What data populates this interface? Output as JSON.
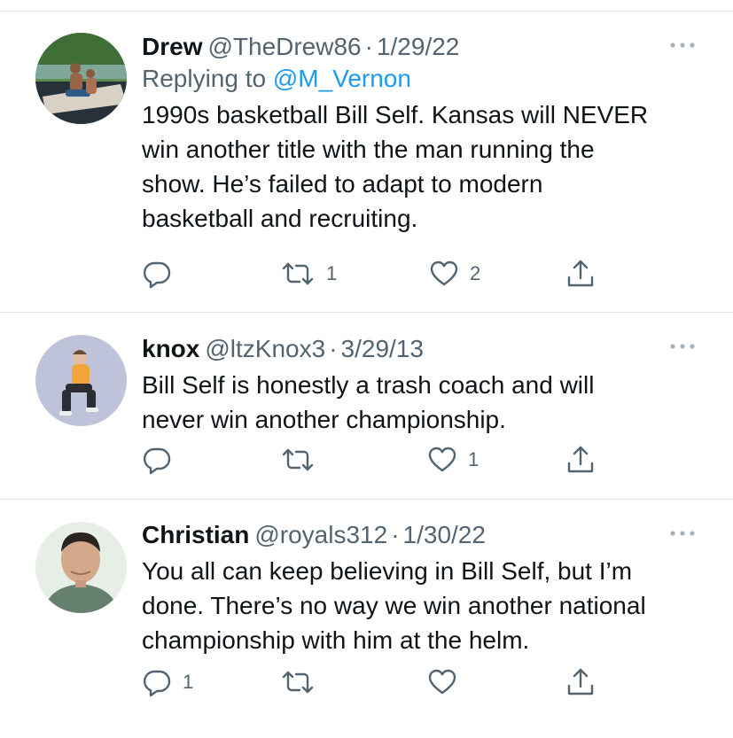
{
  "tweets": [
    {
      "name": "Drew",
      "handle": "@TheDrew86",
      "separator": "·",
      "date": "1/29/22",
      "reply_prefix": "Replying to ",
      "reply_target": "@M_Vernon",
      "text": "1990s basketball Bill Self. Kansas will NEVER\nwin another title with the man running the\nshow. He’s failed to adapt to modern\nbasketball and recruiting.",
      "replies": "",
      "retweets": "1",
      "likes": "2"
    },
    {
      "name": "knox",
      "handle": "@ltzKnox3",
      "separator": "·",
      "date": "3/29/13",
      "text": "Bill Self is honestly a trash coach and will\nnever win another championship.",
      "replies": "",
      "retweets": "",
      "likes": "1"
    },
    {
      "name": "Christian",
      "handle": "@royals312",
      "separator": "·",
      "date": "1/30/22",
      "text": "You all can keep believing in Bill Self, but I’m\ndone. There’s no way we win another national\nchampionship with him at the helm.",
      "replies": "1",
      "retweets": "",
      "likes": ""
    }
  ],
  "icons": {
    "reply": "reply-icon",
    "retweet": "retweet-icon",
    "like": "heart-icon",
    "share": "share-icon",
    "more": "more-icon"
  },
  "colors": {
    "text": "#0f1419",
    "secondary": "#536471",
    "link": "#1d9bf0",
    "divider": "#e1e6ea"
  }
}
